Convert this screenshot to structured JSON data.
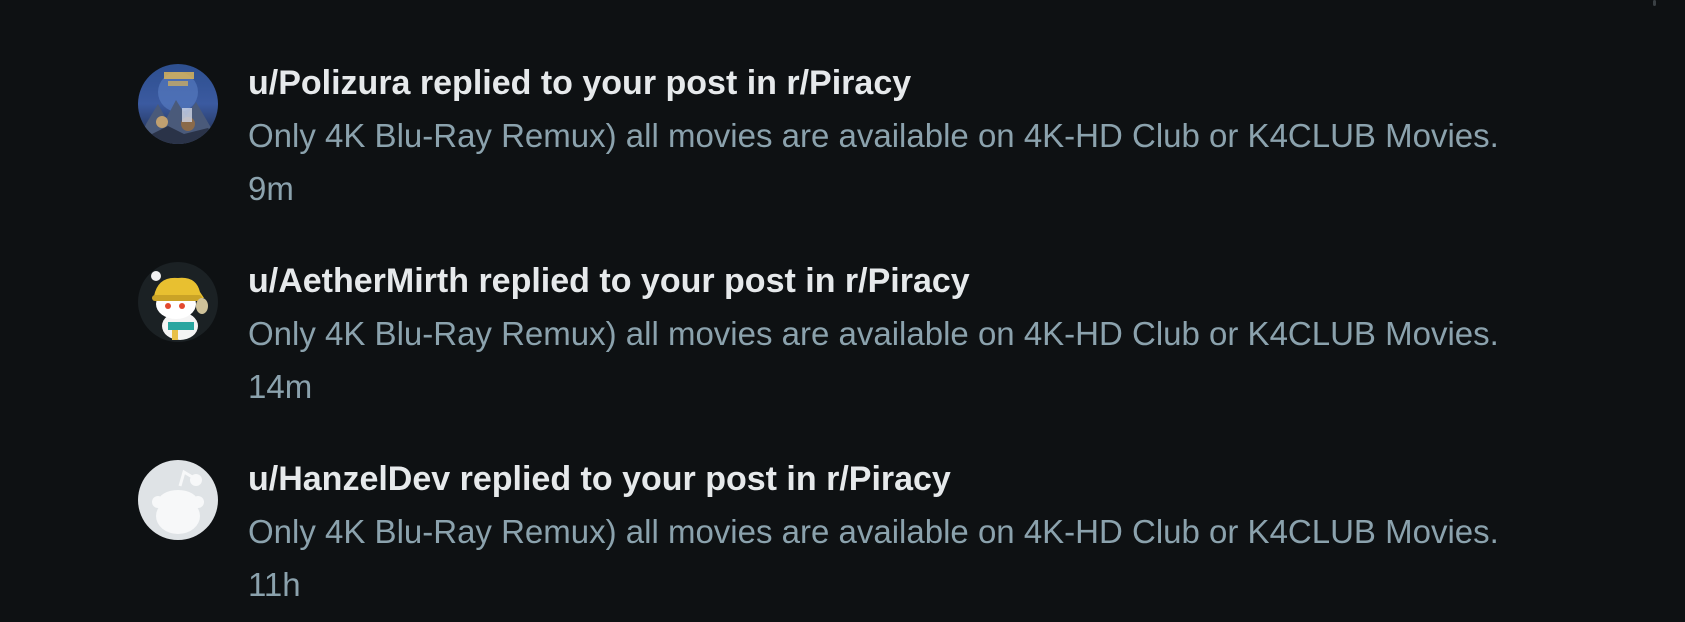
{
  "notifications": [
    {
      "title": "u/Polizura replied to your post in r/Piracy",
      "body": "Only 4K Blu-Ray Remux) all movies are available on 4K-HD Club or K4CLUB Movies.",
      "time": "9m",
      "avatar_icon": "kingdom-game-avatar"
    },
    {
      "title": "u/AetherMirth replied to your post in r/Piracy",
      "body": "Only 4K Blu-Ray Remux) all movies are available on 4K-HD Club or K4CLUB Movies.",
      "time": "14m",
      "avatar_icon": "snoo-yellow-hat-avatar"
    },
    {
      "title": "u/HanzelDev replied to your post in r/Piracy",
      "body": "Only 4K Blu-Ray Remux) all movies are available on 4K-HD Club or K4CLUB Movies.",
      "time": "11h",
      "avatar_icon": "default-snoo-avatar"
    }
  ],
  "colors": {
    "background": "#0e1113",
    "title": "#e6e9eb",
    "secondary": "#8ba2ad"
  }
}
